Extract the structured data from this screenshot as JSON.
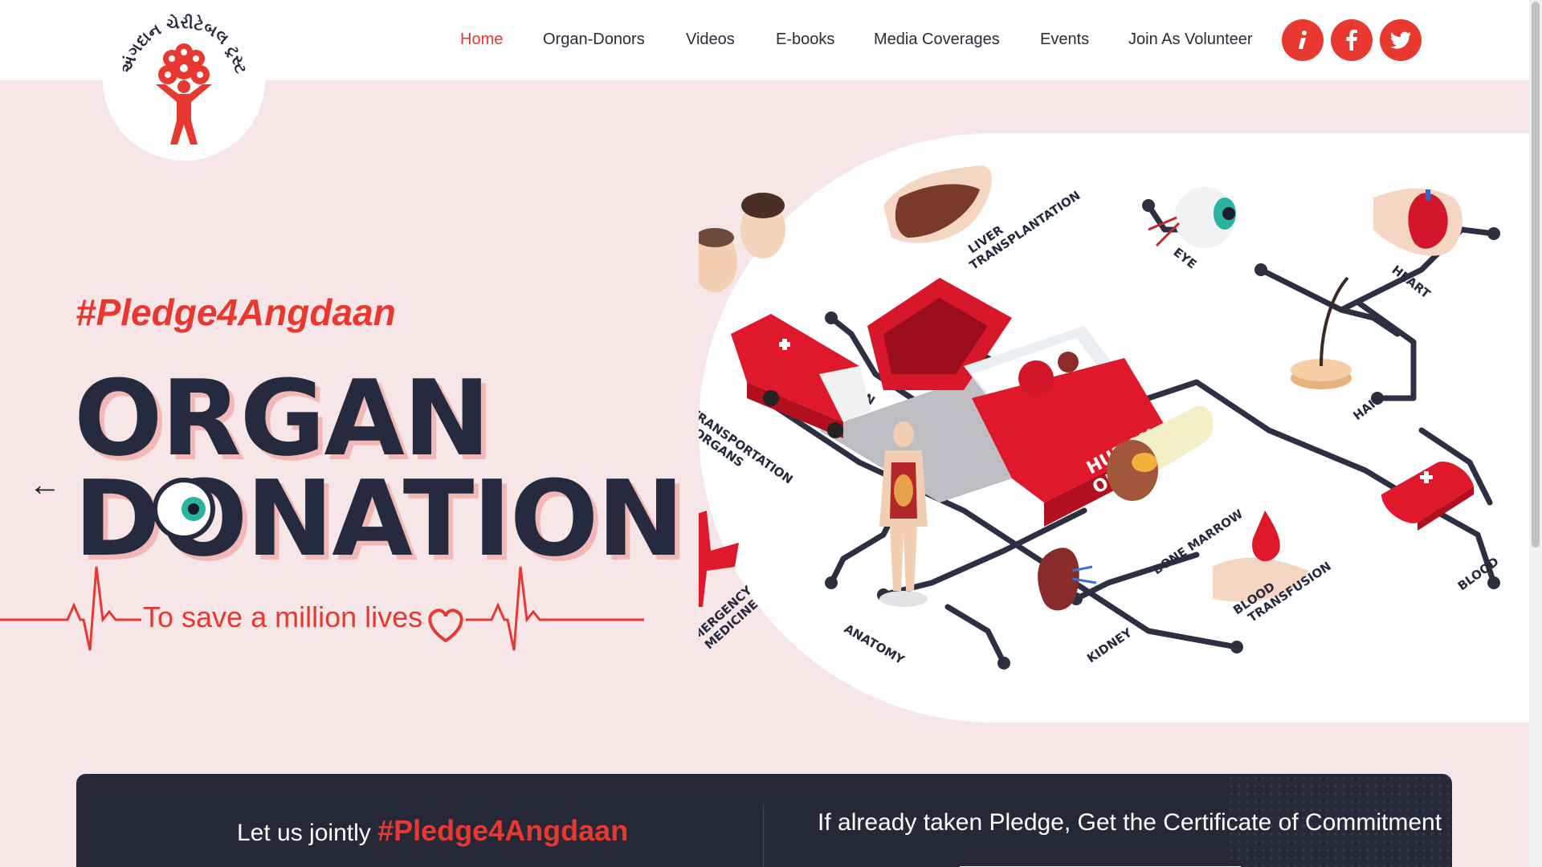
{
  "header": {
    "logo_text": "અંગદાન ચેરીટેબલ ટ્રસ્ટ",
    "nav": [
      {
        "label": "Home",
        "active": true
      },
      {
        "label": "Organ-Donors",
        "active": false
      },
      {
        "label": "Videos",
        "active": false
      },
      {
        "label": "E-books",
        "active": false
      },
      {
        "label": "Media Coverages",
        "active": false
      },
      {
        "label": "Events",
        "active": false
      },
      {
        "label": "Join As Volunteer",
        "active": false
      }
    ],
    "social": [
      {
        "icon": "info-icon"
      },
      {
        "icon": "facebook-icon"
      },
      {
        "icon": "twitter-icon"
      }
    ]
  },
  "hero": {
    "hashtag": "#Pledge4Angdaan",
    "title_line1": "ORGAN",
    "title_line2": "DONATION",
    "tagline": "To save a million lives",
    "prev_arrow": "←",
    "next_arrow": "→"
  },
  "infographic": {
    "labels": {
      "hair_transplantation": [
        "HAIR",
        "TRANSPLANTATION"
      ],
      "liver_transplantation": [
        "LIVER",
        "TRANSPLANTATION"
      ],
      "eye": "EYE",
      "heart": "HEART",
      "hair": "HAIR",
      "transportation": [
        "TRANSPORTATION",
        "OF ORGANS"
      ],
      "human_organ": [
        "HUMAN",
        "ORGAN"
      ],
      "emergency": [
        "EMERGENCY",
        "MEDICINE"
      ],
      "anatomy": "ANATOMY",
      "kidney": "KIDNEY",
      "bone_marrow": "BONE MARROW",
      "blood_transfusion": [
        "BLOOD",
        "TRANSFUSION"
      ],
      "blood": "BLOOD"
    }
  },
  "pledge": {
    "left_prefix": "Let us jointly",
    "left_tag": "#Pledge4Angdaan",
    "right_text": "If already taken Pledge, Get the Certificate of Commitment"
  },
  "colors": {
    "accent": "#e8382f",
    "dark": "#262a3f",
    "background": "#f6e6e7"
  }
}
